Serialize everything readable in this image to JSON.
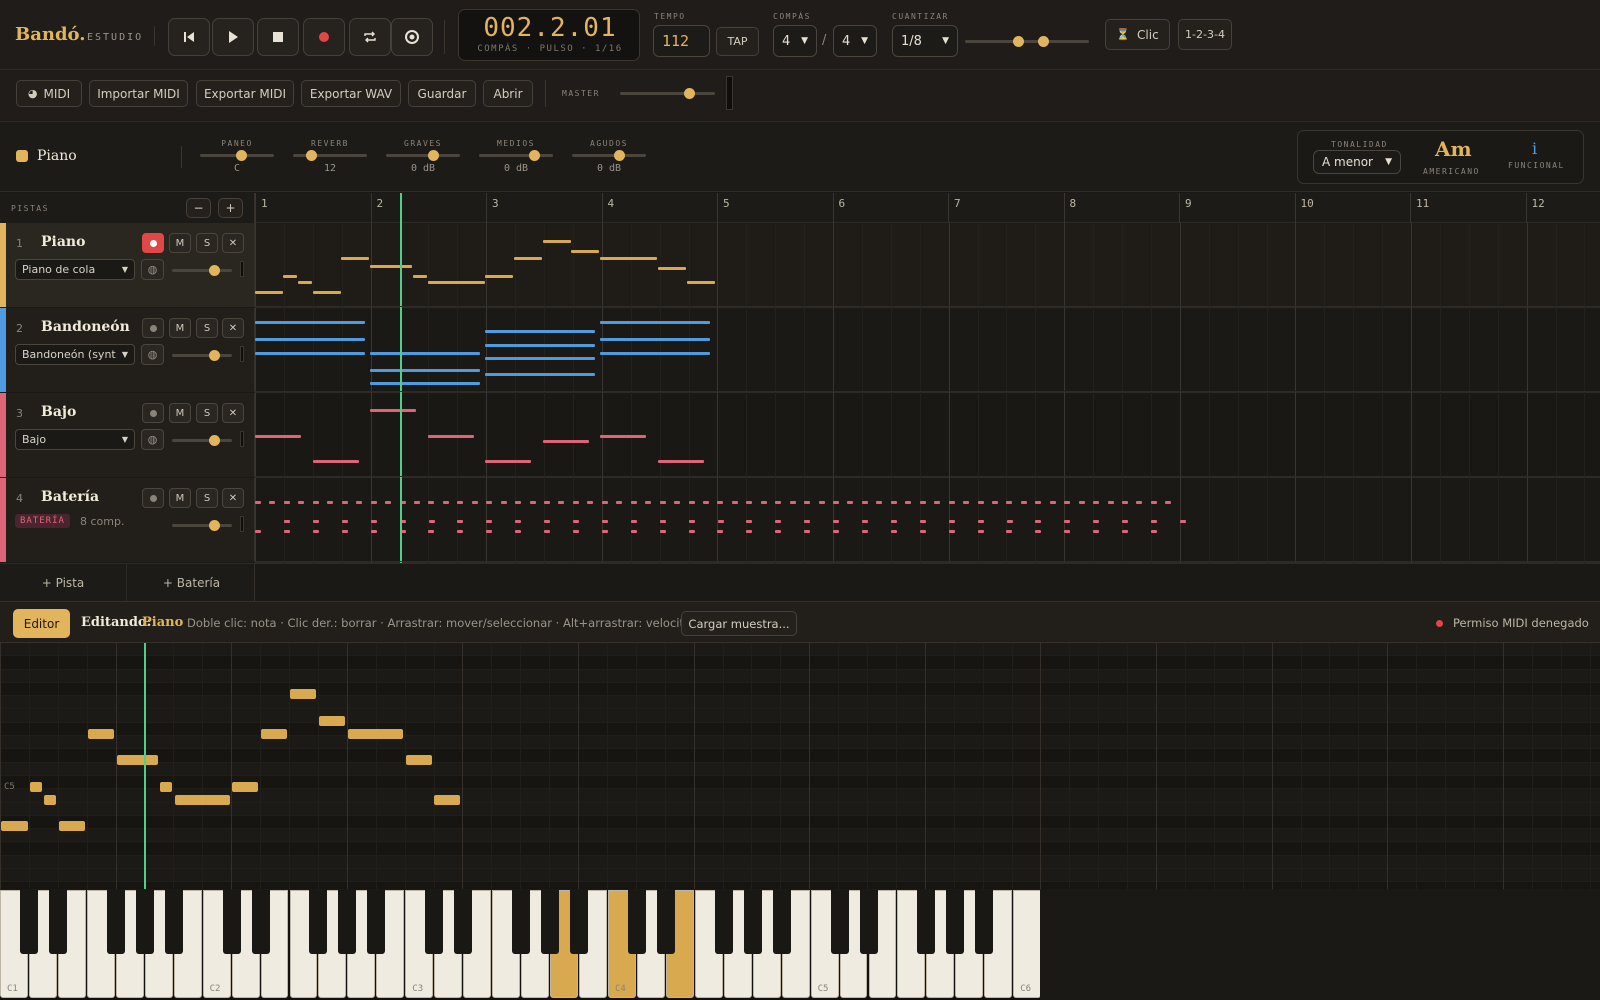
{
  "brand": {
    "name": "Bandó.",
    "sub": "ESTUDIO"
  },
  "transport": {
    "position": "002.2.01",
    "position_sub": "COMPÁS · PULSO · 1/16"
  },
  "tempo": {
    "label": "TEMPO",
    "value": "112",
    "tap": "TAP"
  },
  "meter": {
    "label": "COMPÁS",
    "num": "4",
    "den": "4",
    "sep": "/"
  },
  "quantize": {
    "label": "CUANTIZAR",
    "value": "1/8"
  },
  "metronome": {
    "click": "Clic",
    "countin": "1-2-3-4"
  },
  "toolbar": {
    "midi": "MIDI",
    "import": "Importar MIDI",
    "export_midi": "Exportar MIDI",
    "export_wav": "Exportar WAV",
    "save": "Guardar",
    "open": "Abrir",
    "master": "MASTER"
  },
  "channel": {
    "name": "Piano",
    "color": "#e2b45c",
    "knobs": [
      {
        "label": "PANEO",
        "value": "C"
      },
      {
        "label": "REVERB",
        "value": "12"
      },
      {
        "label": "GRAVES",
        "value": "0 dB"
      },
      {
        "label": "MEDIOS",
        "value": "0 dB"
      },
      {
        "label": "AGUDOS",
        "value": "0 dB"
      }
    ]
  },
  "key": {
    "label": "TONALIDAD",
    "value": "A menor",
    "chord": "Am",
    "chord_sub": "AMERICANO",
    "func": "i",
    "func_sub": "FUNCIONAL"
  },
  "tracks_header": {
    "label": "PISTAS",
    "minus": "−",
    "plus": "+"
  },
  "tracks": [
    {
      "num": "1",
      "name": "Piano",
      "instrument": "Piano de cola",
      "color": "#e2b45c"
    },
    {
      "num": "2",
      "name": "Bandoneón",
      "instrument": "Bandoneón (synt",
      "color": "#4f9be0"
    },
    {
      "num": "3",
      "name": "Bajo",
      "instrument": "Bajo",
      "color": "#e06478"
    },
    {
      "num": "4",
      "name": "Batería",
      "badge": "BATERÍA",
      "info": "8 comp.",
      "color": "#e06478"
    }
  ],
  "track_buttons": {
    "m": "M",
    "s": "S",
    "x": "✕"
  },
  "add": {
    "track": "+ Pista",
    "drums": "+ Batería"
  },
  "ruler": [
    "1",
    "2",
    "3",
    "4",
    "5",
    "6",
    "7",
    "8",
    "9",
    "10",
    "11",
    "12"
  ],
  "editor": {
    "tab": "Editor",
    "editing": "Editando:",
    "target": "Piano",
    "hint": "Doble clic: nota · Clic der.: borrar · Arrastrar: mover/seleccionar · Alt+arrastrar: velocity",
    "load": "Cargar muestra...",
    "midi_status": "Permiso MIDI denegado"
  },
  "piano_roll": {
    "c5_label": "C5"
  },
  "keyboard": {
    "labels": [
      "C1",
      "C2",
      "C3",
      "C4",
      "C5",
      "C6"
    ]
  }
}
